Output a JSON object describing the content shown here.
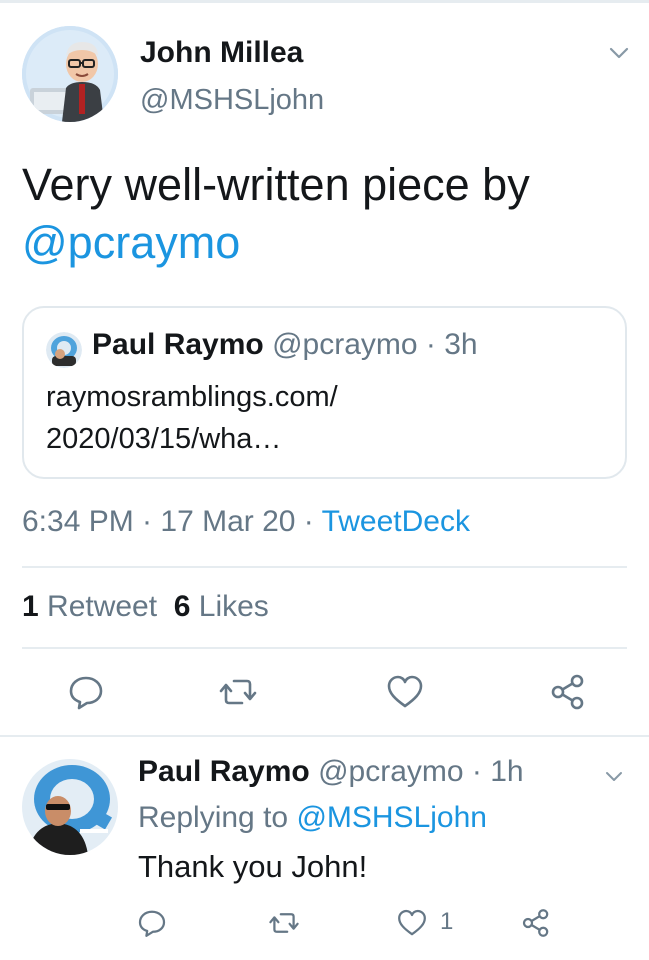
{
  "tweet": {
    "author_name": "John Millea",
    "author_handle": "@MSHSLjohn",
    "text_line1": "Very well-written piece by",
    "text_mention": "@pcraymo",
    "quote": {
      "author_name": "Paul Raymo",
      "author_meta": " @pcraymo · 3h",
      "body_line1": "raymosramblings.com/",
      "body_line2": "2020/03/15/wha…"
    },
    "timestamp": "6:34 PM · 17 Mar 20 · ",
    "source": "TweetDeck",
    "stats": {
      "retweet_count": "1",
      "retweet_label": " Retweet",
      "like_count": "6",
      "like_label": " Likes"
    }
  },
  "reply": {
    "author_name": "Paul Raymo",
    "author_meta": " @pcraymo · 1h",
    "replying_prefix": "Replying to ",
    "replying_handle": "@MSHSLjohn",
    "text": "Thank you John!",
    "like_count": "1"
  },
  "icons": {
    "reply": "reply-icon",
    "retweet": "retweet-icon",
    "like": "heart-icon",
    "share": "share-icon",
    "menu": "chevron-down-icon"
  },
  "colors": {
    "link": "#1b95e0",
    "secondary_text": "#657786",
    "primary_text": "#14171a",
    "divider": "#e6ecf0"
  }
}
